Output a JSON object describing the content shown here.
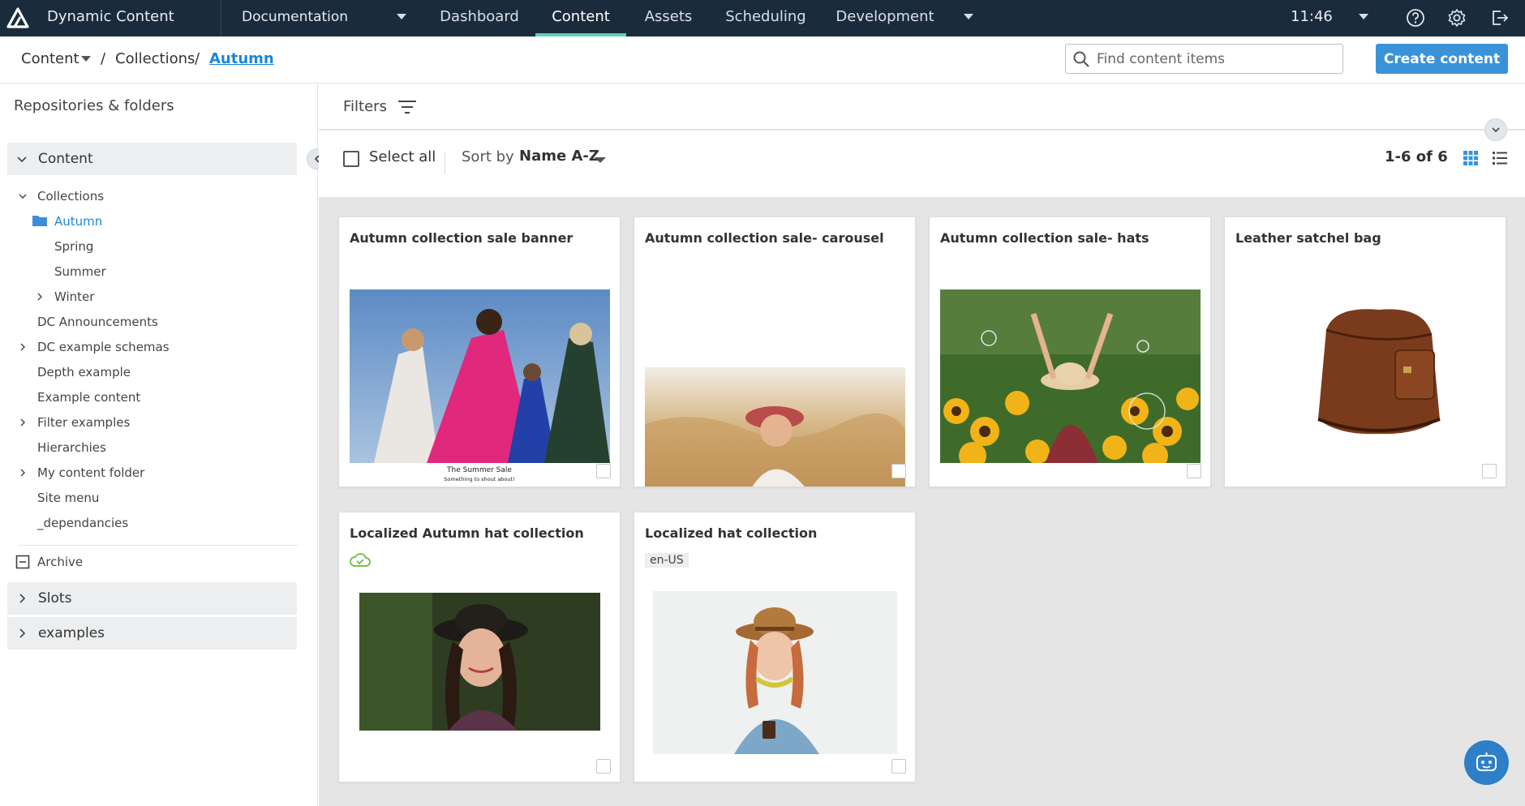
{
  "app": {
    "title": "Dynamic Content"
  },
  "header": {
    "hub": "Documentation",
    "nav": [
      "Dashboard",
      "Content",
      "Assets",
      "Scheduling",
      "Development"
    ],
    "active_nav": "Content",
    "time": "11:46"
  },
  "breadcrumb": {
    "root": "Content",
    "sep": "/",
    "collections": "Collections",
    "current": "Autumn"
  },
  "search": {
    "placeholder": "Find content items",
    "value": ""
  },
  "create_button": "Create content",
  "sidebar": {
    "title": "Repositories & folders",
    "sections": {
      "content": "Content",
      "slots": "Slots",
      "examples": "examples"
    },
    "tree": {
      "collections": "Collections",
      "autumn": "Autumn",
      "spring": "Spring",
      "summer": "Summer",
      "winter": "Winter",
      "dc_announcements": "DC Announcements",
      "dc_example_schemas": "DC example schemas",
      "depth_example": "Depth example",
      "example_content": "Example content",
      "filter_examples": "Filter examples",
      "hierarchies": "Hierarchies",
      "my_content_folder": "My content folder",
      "site_menu": "Site menu",
      "dependancies": "_dependancies",
      "archive": "Archive"
    }
  },
  "filters": {
    "label": "Filters"
  },
  "toolbar": {
    "select_all": "Select all",
    "sort_label": "Sort by",
    "sort_value": "Name A-Z",
    "count": "1-6 of 6"
  },
  "cards": [
    {
      "title": "Autumn collection sale banner",
      "caption1": "The Summer Sale",
      "caption2": "Something to shout about!"
    },
    {
      "title": "Autumn collection sale- carousel"
    },
    {
      "title": "Autumn collection sale- hats"
    },
    {
      "title": "Leather satchel bag"
    },
    {
      "title": "Localized Autumn hat collection"
    },
    {
      "title": "Localized hat collection",
      "locale": "en-US"
    }
  ],
  "colors": {
    "topbar": "#1a2b3c",
    "accent": "#3a93d8",
    "active_tab": "#5fd1b3",
    "link": "#1a87d8"
  },
  "icons": [
    "logo-icon",
    "help-icon",
    "gear-icon",
    "logout-icon",
    "search-icon",
    "filter-icon",
    "grid-view-icon",
    "list-view-icon",
    "folder-icon",
    "archive-icon",
    "cloud-sync-icon",
    "chatbot-icon"
  ]
}
